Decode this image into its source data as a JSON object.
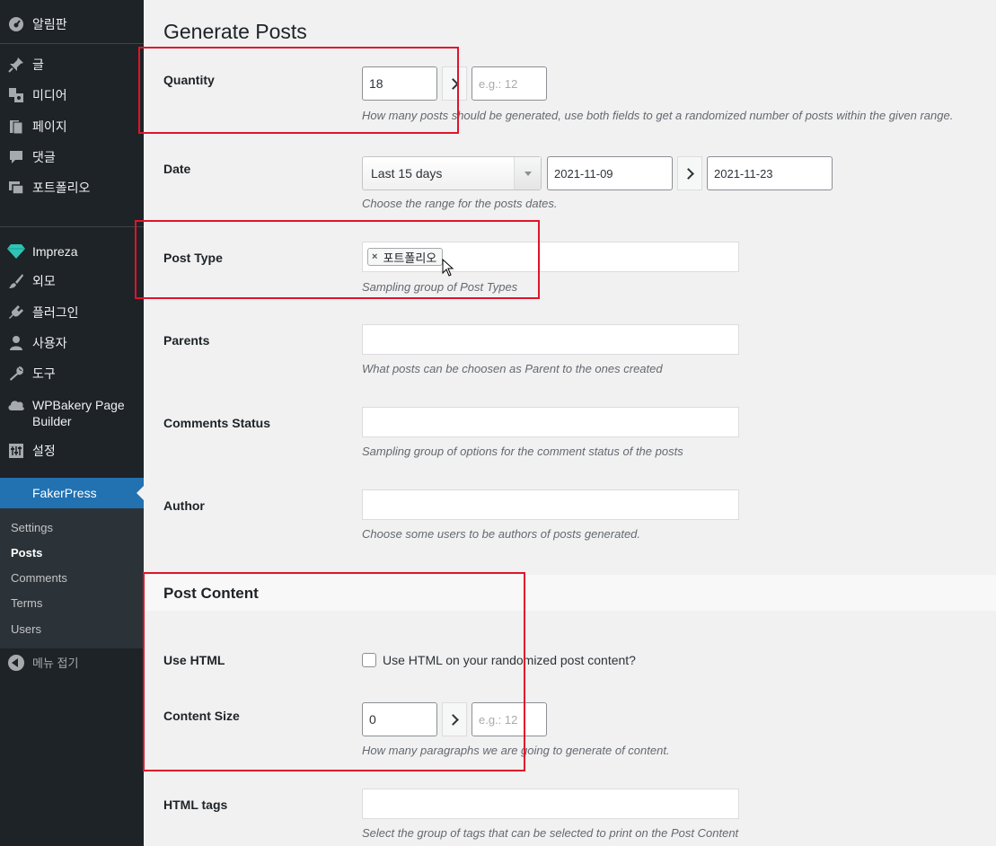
{
  "sidebar": {
    "items": [
      {
        "label": "알림판",
        "icon": "dashboard-icon"
      },
      {
        "label": "글",
        "icon": "pin-icon"
      },
      {
        "label": "미디어",
        "icon": "media-icon"
      },
      {
        "label": "페이지",
        "icon": "page-icon"
      },
      {
        "label": "댓글",
        "icon": "comment-icon"
      },
      {
        "label": "포트폴리오",
        "icon": "portfolio-icon"
      },
      {
        "label": "Impreza",
        "icon": "diamond-icon"
      },
      {
        "label": "외모",
        "icon": "brush-icon"
      },
      {
        "label": "플러그인",
        "icon": "plugin-icon"
      },
      {
        "label": "사용자",
        "icon": "user-icon"
      },
      {
        "label": "도구",
        "icon": "wrench-icon"
      },
      {
        "label": "WPBakery Page Builder",
        "icon": "cloud-icon"
      },
      {
        "label": "설정",
        "icon": "settings-icon"
      }
    ],
    "current": "FakerPress",
    "submenu": [
      "Settings",
      "Posts",
      "Comments",
      "Terms",
      "Users"
    ],
    "active_submenu": "Posts",
    "collapse_label": "메뉴 접기",
    "accent": "#2271b1"
  },
  "main": {
    "title": "Generate Posts",
    "quantity": {
      "label": "Quantity",
      "min_value": "18",
      "max_placeholder": "e.g.: 12",
      "desc": "How many posts should be generated, use both fields to get a randomized number of posts within the given range."
    },
    "date": {
      "label": "Date",
      "range_selected": "Last 15 days",
      "from": "2021-11-09",
      "to": "2021-11-23",
      "desc": "Choose the range for the posts dates."
    },
    "post_type": {
      "label": "Post Type",
      "tag": "포트폴리오",
      "tag_remove": "×",
      "desc": "Sampling group of Post Types"
    },
    "parents": {
      "label": "Parents",
      "desc": "What posts can be choosen as Parent to the ones created"
    },
    "comments_status": {
      "label": "Comments Status",
      "desc": "Sampling group of options for the comment status of the posts"
    },
    "author": {
      "label": "Author",
      "desc": "Choose some users to be authors of posts generated."
    },
    "post_content": {
      "title": "Post Content",
      "use_html": {
        "label": "Use HTML",
        "checkbox_label": "Use HTML on your randomized post content?",
        "checked": false
      },
      "content_size": {
        "label": "Content Size",
        "min_value": "0",
        "max_placeholder": "e.g.: 12",
        "desc": "How many paragraphs we are going to generate of content."
      },
      "html_tags": {
        "label": "HTML tags",
        "desc": "Select the group of tags that can be selected to print on the Post Content"
      }
    },
    "highlight_color": "#e0142a"
  }
}
